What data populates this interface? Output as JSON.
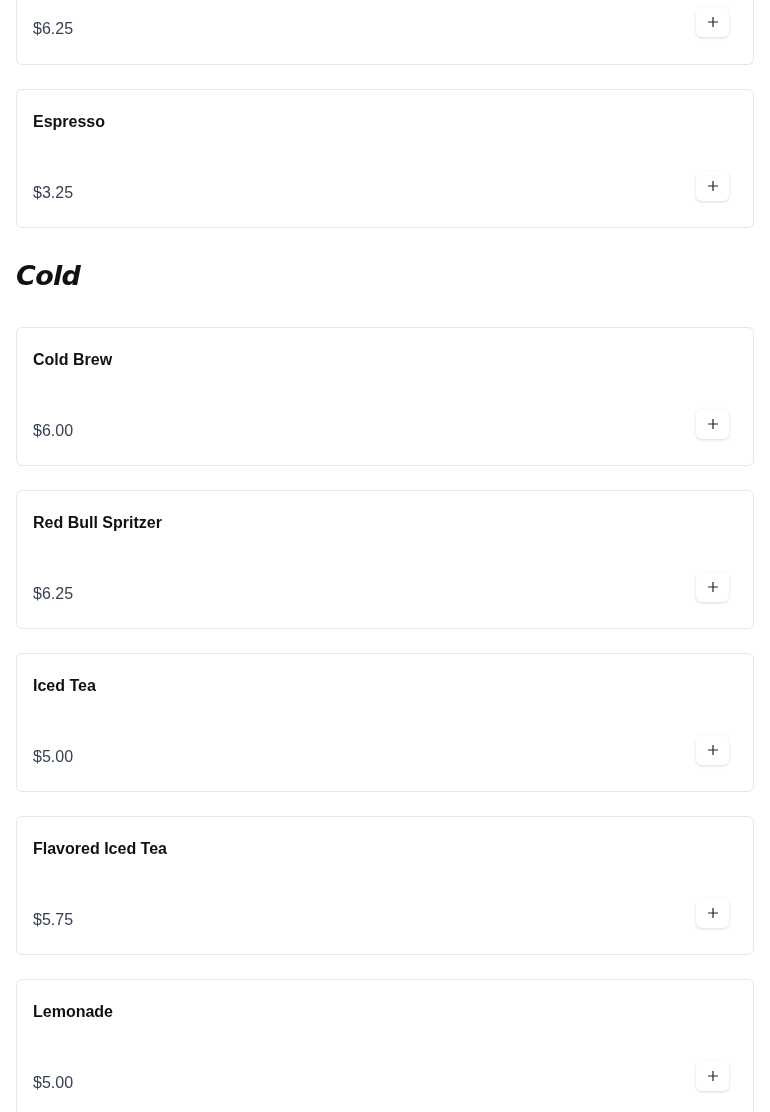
{
  "sections": [
    {
      "items": [
        {
          "price": "$6.25"
        },
        {
          "name": "Espresso",
          "price": "$3.25"
        }
      ]
    },
    {
      "heading": "Cold",
      "items": [
        {
          "name": "Cold Brew",
          "price": "$6.00"
        },
        {
          "name": "Red Bull Spritzer",
          "price": "$6.25"
        },
        {
          "name": "Iced Tea",
          "price": "$5.00"
        },
        {
          "name": "Flavored Iced Tea",
          "price": "$5.75"
        },
        {
          "name": "Lemonade",
          "price": "$5.00"
        }
      ]
    }
  ]
}
